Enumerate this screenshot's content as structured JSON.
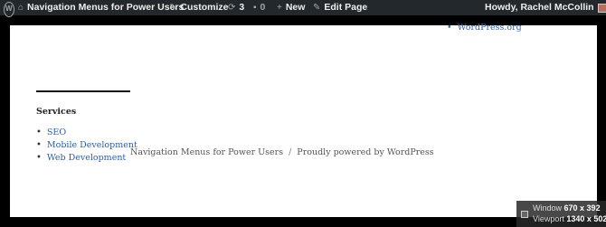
{
  "adminbar": {
    "site_name": "Navigation Menus for Power Users",
    "customize": "Customize",
    "updates_count": "3",
    "comments_count": "0",
    "new_label": "New",
    "edit_label": "Edit Page",
    "howdy": "Howdy, Rachel McCollin"
  },
  "page": {
    "top_link": "WordPress.org",
    "widget_title": "Services",
    "menu": [
      "SEO",
      "Mobile Development",
      "Web Development"
    ],
    "footer_site": "Navigation Menus for Power Users",
    "footer_sep": "/",
    "footer_powered": "Proudly powered by WordPress"
  },
  "sizebox": {
    "window_label": "Window",
    "window_value": "670 x 392",
    "viewport_label": "Viewport",
    "viewport_value": "1340 x 502"
  }
}
